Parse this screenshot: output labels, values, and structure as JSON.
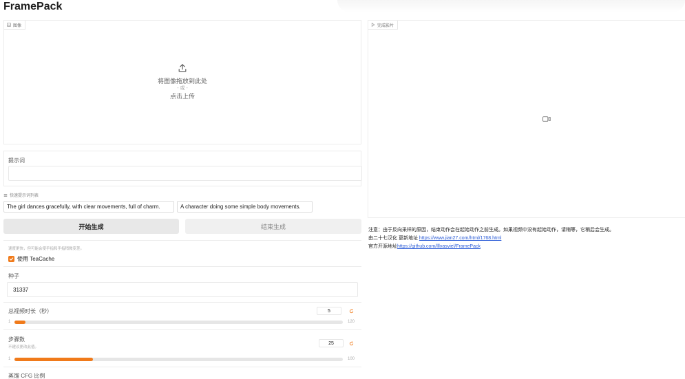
{
  "app": {
    "title": "FramePack"
  },
  "image_input": {
    "tag": "图像",
    "drop_text": "将图像拖放到此处",
    "or_text": "- 或 -",
    "click_text": "点击上传"
  },
  "video_output": {
    "tag": "完成影片"
  },
  "prompt": {
    "label": "提示词",
    "value": ""
  },
  "quick_prompts": {
    "label": "快速提示词列表",
    "items": [
      "The girl dances gracefully, with clear movements, full of charm.",
      "A character doing some simple body movements."
    ]
  },
  "buttons": {
    "start": "开始生成",
    "end": "结束生成"
  },
  "teacache": {
    "hint": "速度更快，但可能会使手指和手指稍微变差。",
    "label": "使用 TeaCache",
    "checked": true
  },
  "seed": {
    "label": "种子",
    "value": "31337"
  },
  "duration": {
    "label": "总视频时长（秒）",
    "value": "5",
    "min": "1",
    "max": "120",
    "fraction": 0.034
  },
  "steps": {
    "label": "步骤数",
    "hint": "不建议更改此值。",
    "value": "25",
    "min": "1",
    "max": "100",
    "fraction": 0.24
  },
  "cfg": {
    "label": "蒸馏 CFG 比例"
  },
  "note": {
    "line1": "注意：由于反向采样的原因，结束动作会在起始动作之前生成。如果视频中没有起始动作，请稍等，它稍后会生成。",
    "line2_prefix": "由二十七汉化 更新地址",
    "line2_link": "https://www.jian27.com/html/1768.html",
    "line3_prefix": "官方开源地址",
    "line3_link": "https://github.com/lllyasviel/FramePack"
  },
  "colors": {
    "accent": "#f07a1a",
    "link": "#2a5bd7"
  },
  "icons": [
    "image-icon",
    "upload-icon",
    "video-icon",
    "list-icon",
    "check-icon",
    "reset-icon"
  ]
}
